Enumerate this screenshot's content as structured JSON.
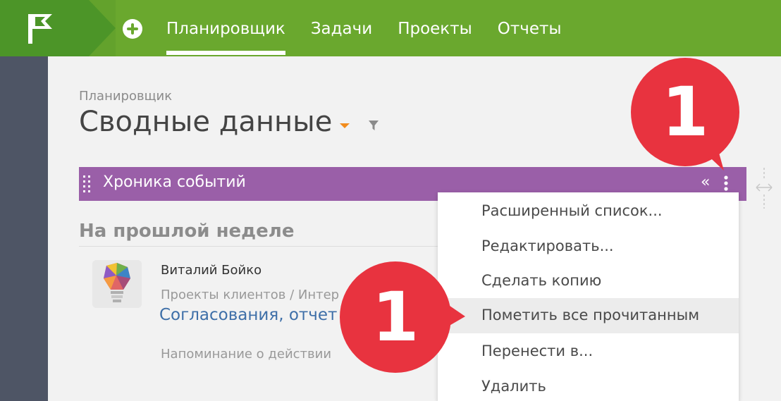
{
  "nav": {
    "add_label": "+",
    "items": [
      {
        "label": "Планировщик",
        "active": true
      },
      {
        "label": "Задачи",
        "active": false
      },
      {
        "label": "Проекты",
        "active": false
      },
      {
        "label": "Отчеты",
        "active": false
      }
    ]
  },
  "page": {
    "breadcrumb": "Планировщик",
    "title": "Сводные данные"
  },
  "widget": {
    "title": "Хроника событий",
    "collapse_label": "«"
  },
  "feed": {
    "section": "На прошлой неделе",
    "entry": {
      "author": "Виталий Бойко",
      "project_path": "Проекты клиентов / Интер",
      "task": "Согласования, отчет",
      "activity": "Напоминание о действии"
    }
  },
  "menu": {
    "items": [
      {
        "label": "Расширенный список..."
      },
      {
        "label": "Редактировать..."
      },
      {
        "label": "Сделать копию"
      },
      {
        "label": "Пометить все прочитанным"
      },
      {
        "label": "Перенести в..."
      },
      {
        "label": "Удалить"
      }
    ]
  },
  "callouts": {
    "top": "1",
    "menu": "1"
  },
  "colors": {
    "topbar": "#6aa82e",
    "logo_bg": "#4c9528",
    "sidebar": "#4e5565",
    "widget_header": "#9a5fa8",
    "callout": "#e8333f",
    "link": "#3e6fa8",
    "dropdown_caret": "#f28c1d"
  },
  "icons": [
    "flag-logo-icon",
    "plus-circle-icon",
    "caret-down-icon",
    "filter-icon",
    "drag-handle-icon",
    "collapse-left-icon",
    "vertical-dots-icon",
    "resize-horizontal-icon"
  ]
}
